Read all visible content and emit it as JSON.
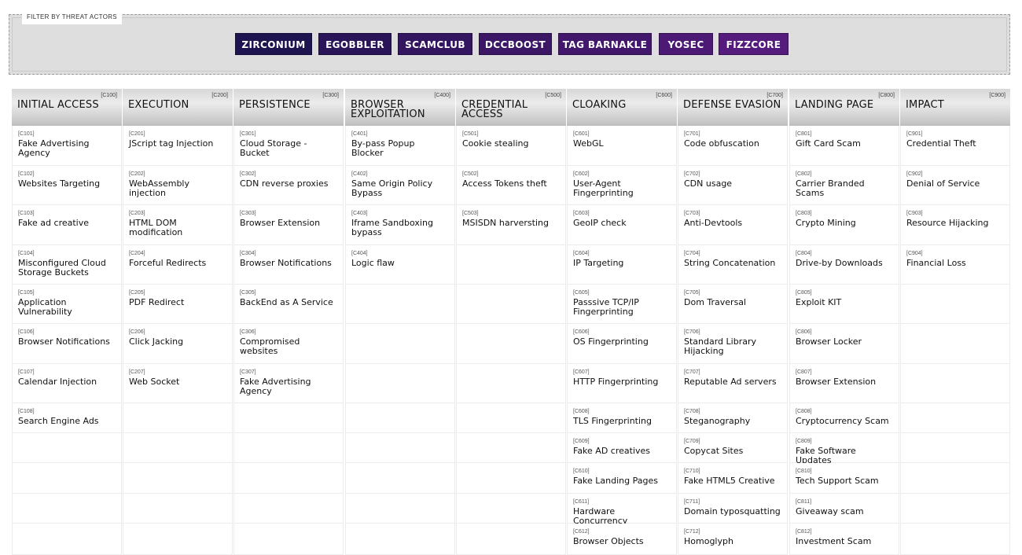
{
  "filter": {
    "legend": "FILTER BY THREAT ACTORS",
    "actors": [
      {
        "label": "ZIRCONIUM",
        "color": "#1e1550"
      },
      {
        "label": "EGOBBLER",
        "color": "#2a1558"
      },
      {
        "label": "SCAMCLUB",
        "color": "#33165f"
      },
      {
        "label": "DCCBOOST",
        "color": "#3b1766"
      },
      {
        "label": "TAG BARNAKLE",
        "color": "#43186c"
      },
      {
        "label": "YOSEC",
        "color": "#4c1a74"
      },
      {
        "label": "FIZZCORE",
        "color": "#561c7d"
      }
    ]
  },
  "columns": [
    {
      "code": "[C100]",
      "title": "INITIAL ACCESS",
      "items": [
        {
          "code": "[C101]",
          "name": "Fake Advertising Agency"
        },
        {
          "code": "[C102]",
          "name": "Websites Targeting"
        },
        {
          "code": "[C103]",
          "name": "Fake ad creative"
        },
        {
          "code": "[C104]",
          "name": "Misconfigured Cloud Storage Buckets"
        },
        {
          "code": "[C105]",
          "name": "Application Vulnerability"
        },
        {
          "code": "[C106]",
          "name": "Browser Notifications"
        },
        {
          "code": "[C107]",
          "name": "Calendar Injection"
        },
        {
          "code": "[C108]",
          "name": "Search Engine Ads"
        }
      ]
    },
    {
      "code": "[C200]",
      "title": "EXECUTION",
      "items": [
        {
          "code": "[C201]",
          "name": "JScript tag Injection"
        },
        {
          "code": "[C202]",
          "name": "WebAssembly injection"
        },
        {
          "code": "[C203]",
          "name": "HTML DOM modification"
        },
        {
          "code": "[C204]",
          "name": "Forceful Redirects"
        },
        {
          "code": "[C205]",
          "name": "PDF Redirect"
        },
        {
          "code": "[C206]",
          "name": "Click Jacking"
        },
        {
          "code": "[C207]",
          "name": "Web Socket"
        }
      ]
    },
    {
      "code": "[C300]",
      "title": "PERSISTENCE",
      "items": [
        {
          "code": "[C301]",
          "name": "Cloud Storage - Bucket"
        },
        {
          "code": "[C302]",
          "name": "CDN reverse proxies"
        },
        {
          "code": "[C303]",
          "name": "Browser Extension"
        },
        {
          "code": "[C304]",
          "name": "Browser Notifications"
        },
        {
          "code": "[C305]",
          "name": "BackEnd as A Service"
        },
        {
          "code": "[C306]",
          "name": "Compromised websites"
        },
        {
          "code": "[C307]",
          "name": "Fake Advertising Agency"
        }
      ]
    },
    {
      "code": "[C400]",
      "title": "BROWSER EXPLOITATION",
      "items": [
        {
          "code": "[C401]",
          "name": "By-pass Popup Blocker"
        },
        {
          "code": "[C402]",
          "name": "Same Origin Policy Bypass"
        },
        {
          "code": "[C403]",
          "name": "Iframe Sandboxing bypass"
        },
        {
          "code": "[C404]",
          "name": "Logic flaw"
        }
      ]
    },
    {
      "code": "[C500]",
      "title": "CREDENTIAL ACCESS",
      "items": [
        {
          "code": "[C501]",
          "name": "Cookie stealing"
        },
        {
          "code": "[C502]",
          "name": "Access Tokens theft"
        },
        {
          "code": "[C503]",
          "name": "MSISDN harversting"
        }
      ]
    },
    {
      "code": "[C600]",
      "title": "CLOAKING",
      "items": [
        {
          "code": "[C601]",
          "name": "WebGL"
        },
        {
          "code": "[C602]",
          "name": "User-Agent Fingerprinting"
        },
        {
          "code": "[C603]",
          "name": "GeoIP check"
        },
        {
          "code": "[C604]",
          "name": "IP Targeting"
        },
        {
          "code": "[C605]",
          "name": "Passsive TCP/IP Fingerprinting"
        },
        {
          "code": "[C606]",
          "name": "OS Fingerprinting"
        },
        {
          "code": "[C607]",
          "name": "HTTP Fingerprinting"
        },
        {
          "code": "[C608]",
          "name": "TLS Fingerprinting"
        },
        {
          "code": "[C609]",
          "name": "Fake AD creatives"
        },
        {
          "code": "[C610]",
          "name": "Fake Landing Pages"
        },
        {
          "code": "[C611]",
          "name": "Hardware Concurrency"
        },
        {
          "code": "[C612]",
          "name": "Browser Objects"
        }
      ]
    },
    {
      "code": "[C700]",
      "title": "DEFENSE EVASION",
      "items": [
        {
          "code": "[C701]",
          "name": "Code obfuscation"
        },
        {
          "code": "[C702]",
          "name": "CDN usage"
        },
        {
          "code": "[C703]",
          "name": "Anti-Devtools"
        },
        {
          "code": "[C704]",
          "name": "String Concatenation"
        },
        {
          "code": "[C705]",
          "name": "Dom Traversal"
        },
        {
          "code": "[C706]",
          "name": "Standard Library Hijacking"
        },
        {
          "code": "[C707]",
          "name": "Reputable Ad servers"
        },
        {
          "code": "[C708]",
          "name": "Steganography"
        },
        {
          "code": "[C709]",
          "name": "Copycat Sites"
        },
        {
          "code": "[C710]",
          "name": "Fake HTML5 Creative"
        },
        {
          "code": "[C711]",
          "name": "Domain typosquatting"
        },
        {
          "code": "[C712]",
          "name": "Homoglyph"
        }
      ]
    },
    {
      "code": "[C800]",
      "title": "LANDING PAGE",
      "items": [
        {
          "code": "[C801]",
          "name": "Gift Card Scam"
        },
        {
          "code": "[C802]",
          "name": "Carrier Branded Scams"
        },
        {
          "code": "[C803]",
          "name": "Crypto Mining"
        },
        {
          "code": "[C804]",
          "name": "Drive-by Downloads"
        },
        {
          "code": "[C805]",
          "name": "Exploit KIT"
        },
        {
          "code": "[C806]",
          "name": "Browser Locker"
        },
        {
          "code": "[C807]",
          "name": "Browser Extension"
        },
        {
          "code": "[C808]",
          "name": "Cryptocurrency Scam"
        },
        {
          "code": "[C809]",
          "name": "Fake Software Updates"
        },
        {
          "code": "[C810]",
          "name": "Tech Support Scam"
        },
        {
          "code": "[C811]",
          "name": "Giveaway scam"
        },
        {
          "code": "[C812]",
          "name": "Investment Scam"
        }
      ]
    },
    {
      "code": "[C900]",
      "title": "IMPACT",
      "items": [
        {
          "code": "[C901]",
          "name": "Credential Theft"
        },
        {
          "code": "[C902]",
          "name": "Denial of Service"
        },
        {
          "code": "[C903]",
          "name": "Resource Hijacking"
        },
        {
          "code": "[C904]",
          "name": "Financial Loss"
        }
      ]
    }
  ]
}
